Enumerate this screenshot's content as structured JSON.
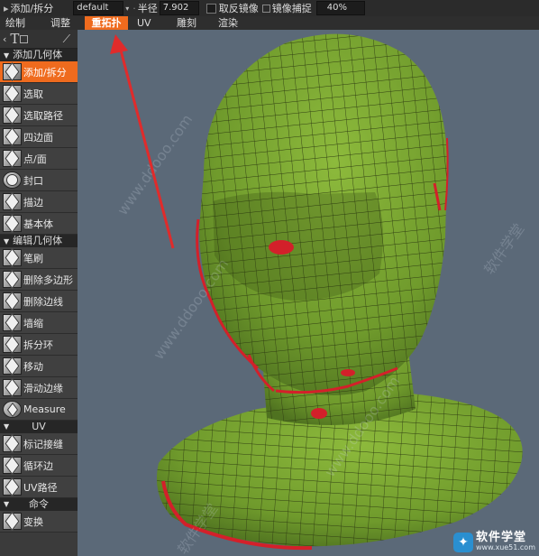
{
  "topbar": {
    "mode_label": "添加/拆分",
    "preset_value": "default",
    "radius_label": "半径",
    "radius_value": "7.902",
    "mirror_label": "取反镜像",
    "mirror_snap_label": "镜像捕捉",
    "snap_value": "40%"
  },
  "tabs": [
    {
      "label": "绘制",
      "active": false
    },
    {
      "label": "调整",
      "active": false
    },
    {
      "label": "重拓扑",
      "active": true
    },
    {
      "label": "UV",
      "active": false
    },
    {
      "label": "雕刻",
      "active": false
    },
    {
      "label": "渲染",
      "active": false
    }
  ],
  "sidebar": {
    "tools_text_icon": "T",
    "sections": [
      {
        "title": "添加几何体",
        "items": [
          {
            "label": "添加/拆分",
            "active": true,
            "icon": "add-split-icon"
          },
          {
            "label": "选取",
            "icon": "select-icon"
          },
          {
            "label": "选取路径",
            "icon": "select-path-icon"
          },
          {
            "label": "四边面",
            "icon": "quad-icon"
          },
          {
            "label": "点/面",
            "icon": "point-face-icon"
          },
          {
            "label": "封口",
            "icon": "cap-icon"
          },
          {
            "label": "描边",
            "icon": "stroke-icon"
          },
          {
            "label": "基本体",
            "icon": "primitive-icon"
          }
        ]
      },
      {
        "title": "编辑几何体",
        "items": [
          {
            "label": "笔刷",
            "icon": "brush-icon"
          },
          {
            "label": "删除多边形",
            "icon": "delete-polygon-icon"
          },
          {
            "label": "删除边线",
            "icon": "delete-edge-icon"
          },
          {
            "label": "墙缩",
            "icon": "shrink-icon"
          },
          {
            "label": "拆分环",
            "icon": "split-ring-icon"
          },
          {
            "label": "移动",
            "icon": "move-icon"
          },
          {
            "label": "滑动边缘",
            "icon": "slide-edge-icon"
          },
          {
            "label": "Measure",
            "icon": "measure-icon"
          }
        ]
      },
      {
        "title": "UV",
        "items": [
          {
            "label": "标记接缝",
            "icon": "mark-seam-icon"
          },
          {
            "label": "循环边",
            "icon": "edge-loop-icon"
          },
          {
            "label": "UV路径",
            "icon": "uv-path-icon"
          }
        ]
      },
      {
        "title": "命令",
        "items": [
          {
            "label": "变换",
            "icon": "transform-icon"
          }
        ]
      }
    ]
  },
  "watermark": {
    "site_text": "www.ddooo.com",
    "side_text": "软件学堂",
    "logo_title": "软件学堂",
    "logo_url": "www.xue51.com"
  },
  "colors": {
    "active_orange": "#ef6b1e",
    "mesh_green": "#7da535",
    "seam_red": "#d3202a",
    "viewport_bg": "#5b6978",
    "arrow_red": "#e02b2b"
  }
}
